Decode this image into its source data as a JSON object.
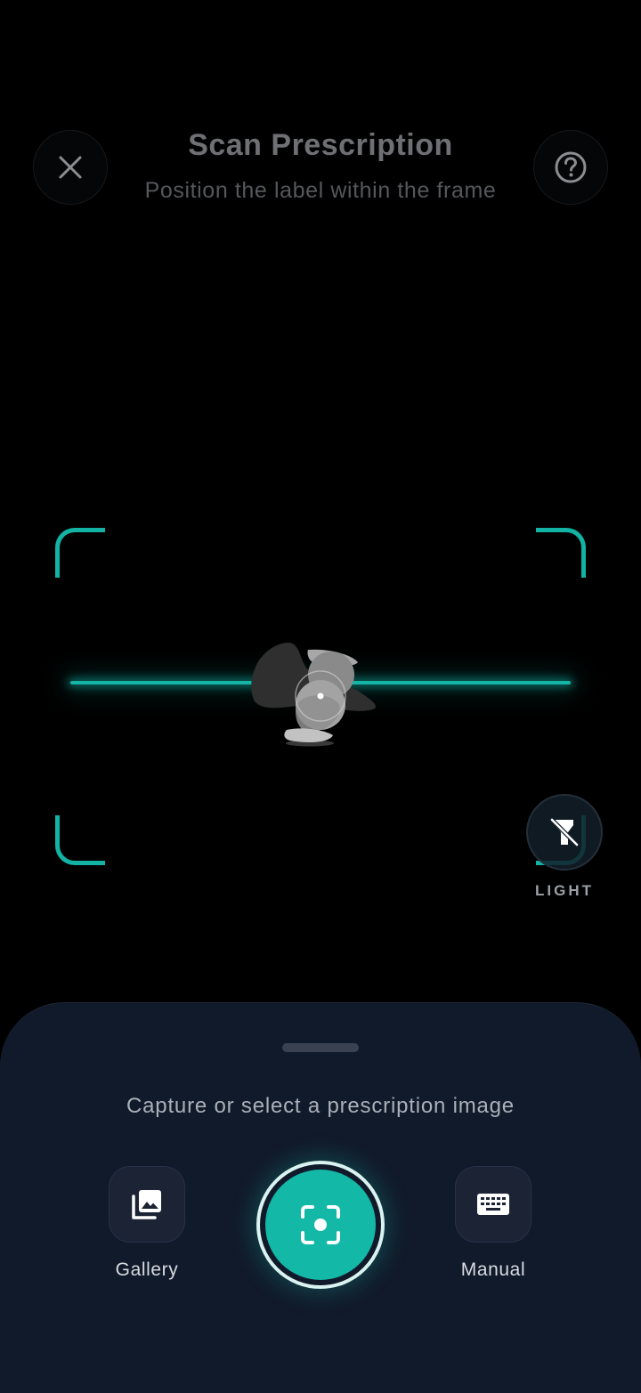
{
  "header": {
    "title": "Scan Prescription",
    "subtitle": "Position the label within the frame",
    "close_icon": "close-icon",
    "help_icon": "help-circle-icon"
  },
  "scanner": {
    "frame_color": "#12B3A5",
    "scan_line_color": "#14B5A7",
    "loading_graphic": "hourglass-timer-icon"
  },
  "light_toggle": {
    "label": "LIGHT",
    "icon": "flashlight-off-icon"
  },
  "bottom_sheet": {
    "caption": "Capture or select a prescription image",
    "gallery": {
      "label": "Gallery",
      "icon": "gallery-icon"
    },
    "capture": {
      "icon": "capture-focus-icon",
      "color": "#14B8A6"
    },
    "manual": {
      "label": "Manual",
      "icon": "keyboard-icon"
    }
  }
}
